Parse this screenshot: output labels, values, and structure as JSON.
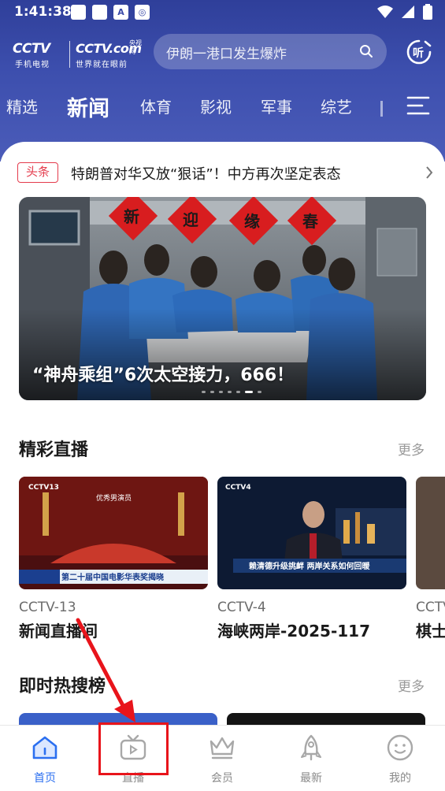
{
  "status_bar": {
    "time": "1:41:38",
    "left_icons": [
      "app-icon",
      "app-icon",
      "a-icon",
      "camera-icon"
    ],
    "right_icons": [
      "wifi-icon",
      "signal-icon",
      "battery-icon"
    ]
  },
  "logo": {
    "brand_main": "CCTV",
    "brand_main_sub": "手机电视",
    "brand_com": "CCTV.com",
    "brand_com_small": "央视网",
    "brand_com_sub": "世界就在眼前"
  },
  "search": {
    "placeholder": "伊朗一港口发生爆炸",
    "icon": "search-icon"
  },
  "listen": {
    "label": "听"
  },
  "tabs": [
    {
      "label": "精选"
    },
    {
      "label": "新闻"
    },
    {
      "label": "体育"
    },
    {
      "label": "影视"
    },
    {
      "label": "军事"
    },
    {
      "label": "综艺"
    }
  ],
  "active_tab": "新闻",
  "headline": {
    "badge": "头条",
    "text": "特朗普对华又放“狠话”！中方再次坚定表态"
  },
  "hero": {
    "caption": "“神舟乘组”6次太空接力，666！",
    "banner_chars": [
      "新",
      "迎",
      "缘",
      "春"
    ],
    "slide_count": 7,
    "active_slide": 6
  },
  "live_section": {
    "title": "精彩直播",
    "more": "更多",
    "cards": [
      {
        "channel": "CCTV-13",
        "title": "新闻直播间",
        "overlay_text": "第二十届中国电影华表奖揭晓",
        "stage_text": "优秀男演员"
      },
      {
        "channel": "CCTV-4",
        "title": "海峡两岸-2025-117",
        "overlay_text": "赖清德升级挑衅 两岸关系如何回暖"
      },
      {
        "channel": "CCTV",
        "title": "棋士"
      }
    ]
  },
  "hot_section": {
    "title": "即时热搜榜",
    "more": "更多"
  },
  "bottom_nav": [
    {
      "label": "首页",
      "icon": "home-icon",
      "active": true
    },
    {
      "label": "直播",
      "icon": "tv-icon",
      "active": false
    },
    {
      "label": "会员",
      "icon": "crown-icon",
      "active": false
    },
    {
      "label": "最新",
      "icon": "rocket-icon",
      "active": false
    },
    {
      "label": "我的",
      "icon": "profile-icon",
      "active": false
    }
  ],
  "colors": {
    "header": "#3d4fae",
    "accent_red": "#e43b4c",
    "nav_active": "#2b6ff0",
    "annotation": "#e8141b"
  }
}
